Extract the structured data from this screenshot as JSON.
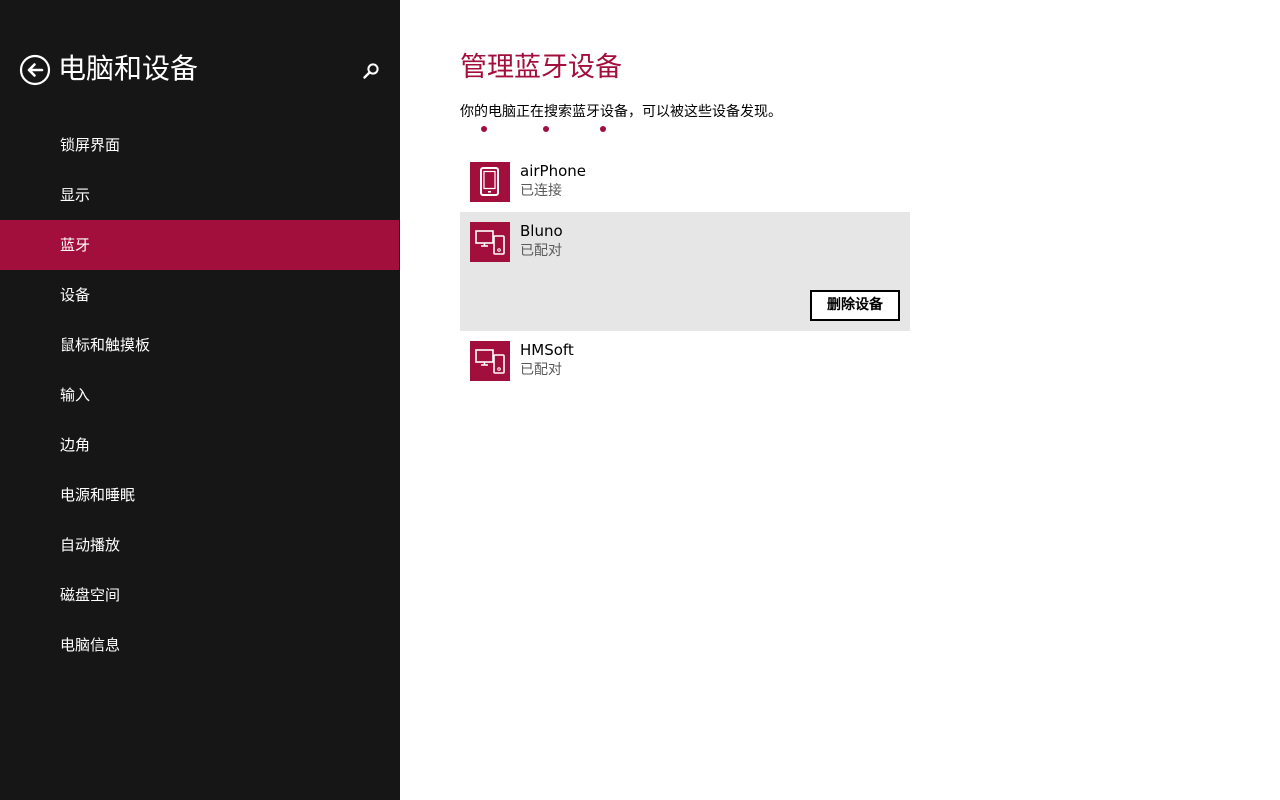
{
  "sidebar": {
    "title": "电脑和设备",
    "items": [
      {
        "label": "锁屏界面",
        "selected": false
      },
      {
        "label": "显示",
        "selected": false
      },
      {
        "label": "蓝牙",
        "selected": true
      },
      {
        "label": "设备",
        "selected": false
      },
      {
        "label": "鼠标和触摸板",
        "selected": false
      },
      {
        "label": "输入",
        "selected": false
      },
      {
        "label": "边角",
        "selected": false
      },
      {
        "label": "电源和睡眠",
        "selected": false
      },
      {
        "label": "自动播放",
        "selected": false
      },
      {
        "label": "磁盘空间",
        "selected": false
      },
      {
        "label": "电脑信息",
        "selected": false
      }
    ]
  },
  "main": {
    "title": "管理蓝牙设备",
    "status_text": "你的电脑正在搜索蓝牙设备，可以被这些设备发现。",
    "devices": [
      {
        "name": "airPhone",
        "status": "已连接",
        "icon": "phone-icon"
      },
      {
        "name": "Bluno",
        "status": "已配对",
        "icon": "computer-phone-icon",
        "expanded": true,
        "action_label": "删除设备"
      },
      {
        "name": "HMSoft",
        "status": "已配对",
        "icon": "computer-phone-icon"
      }
    ]
  },
  "colors": {
    "accent": "#a20f3c",
    "sidebar_background": "#161616",
    "content_background": "#ffffff",
    "expanded_item_background": "#e6e6e6"
  }
}
